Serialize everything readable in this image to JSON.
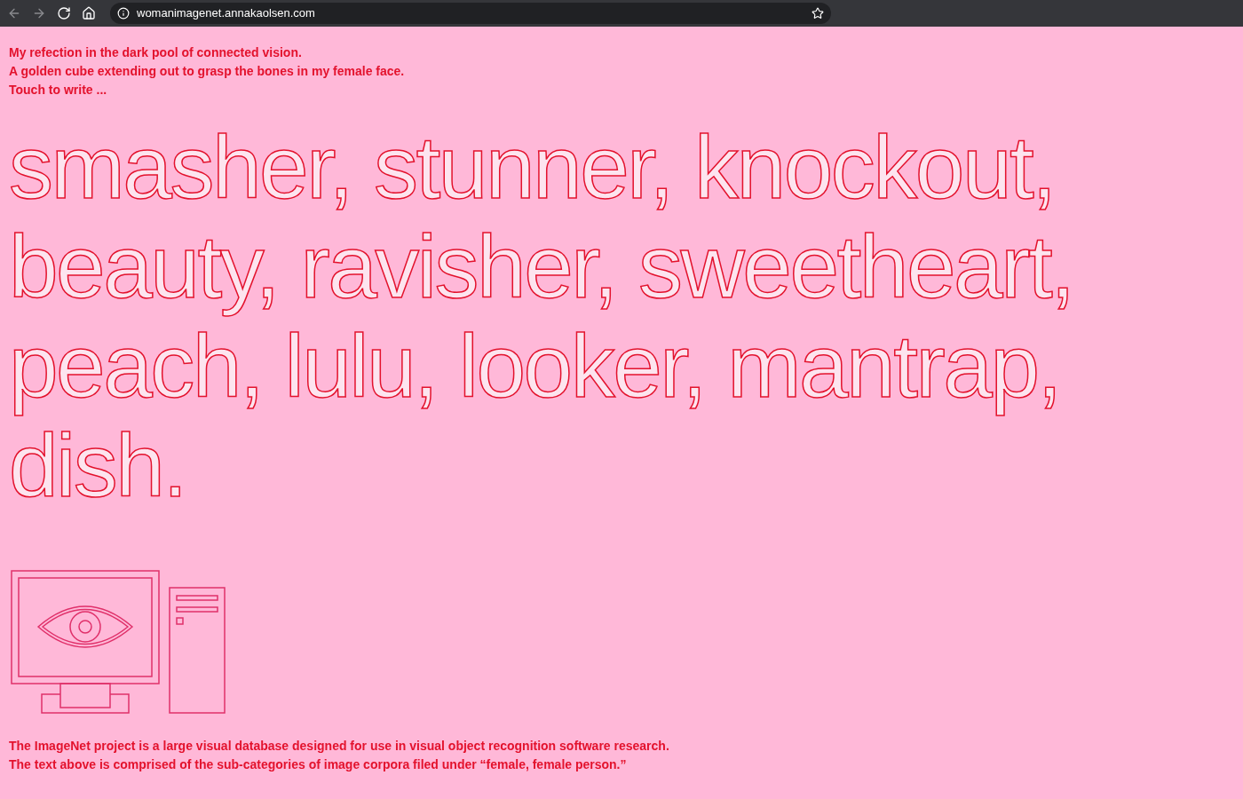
{
  "browser": {
    "url": "womanimagenet.annakaolsen.com"
  },
  "intro": [
    "My refection in the dark pool of connected vision.",
    "A golden cube extending out to grasp the bones in my female face.",
    "Touch to write ..."
  ],
  "headline": "smasher, stunner, knockout, beauty, ravisher, sweetheart, peach, lulu, looker, mantrap, dish.",
  "footer": [
    "The ImageNet project is a large visual database designed for use in visual object recognition software research.",
    "The text above is comprised of the sub-categories of image corpora filed under “female, female person.”"
  ]
}
